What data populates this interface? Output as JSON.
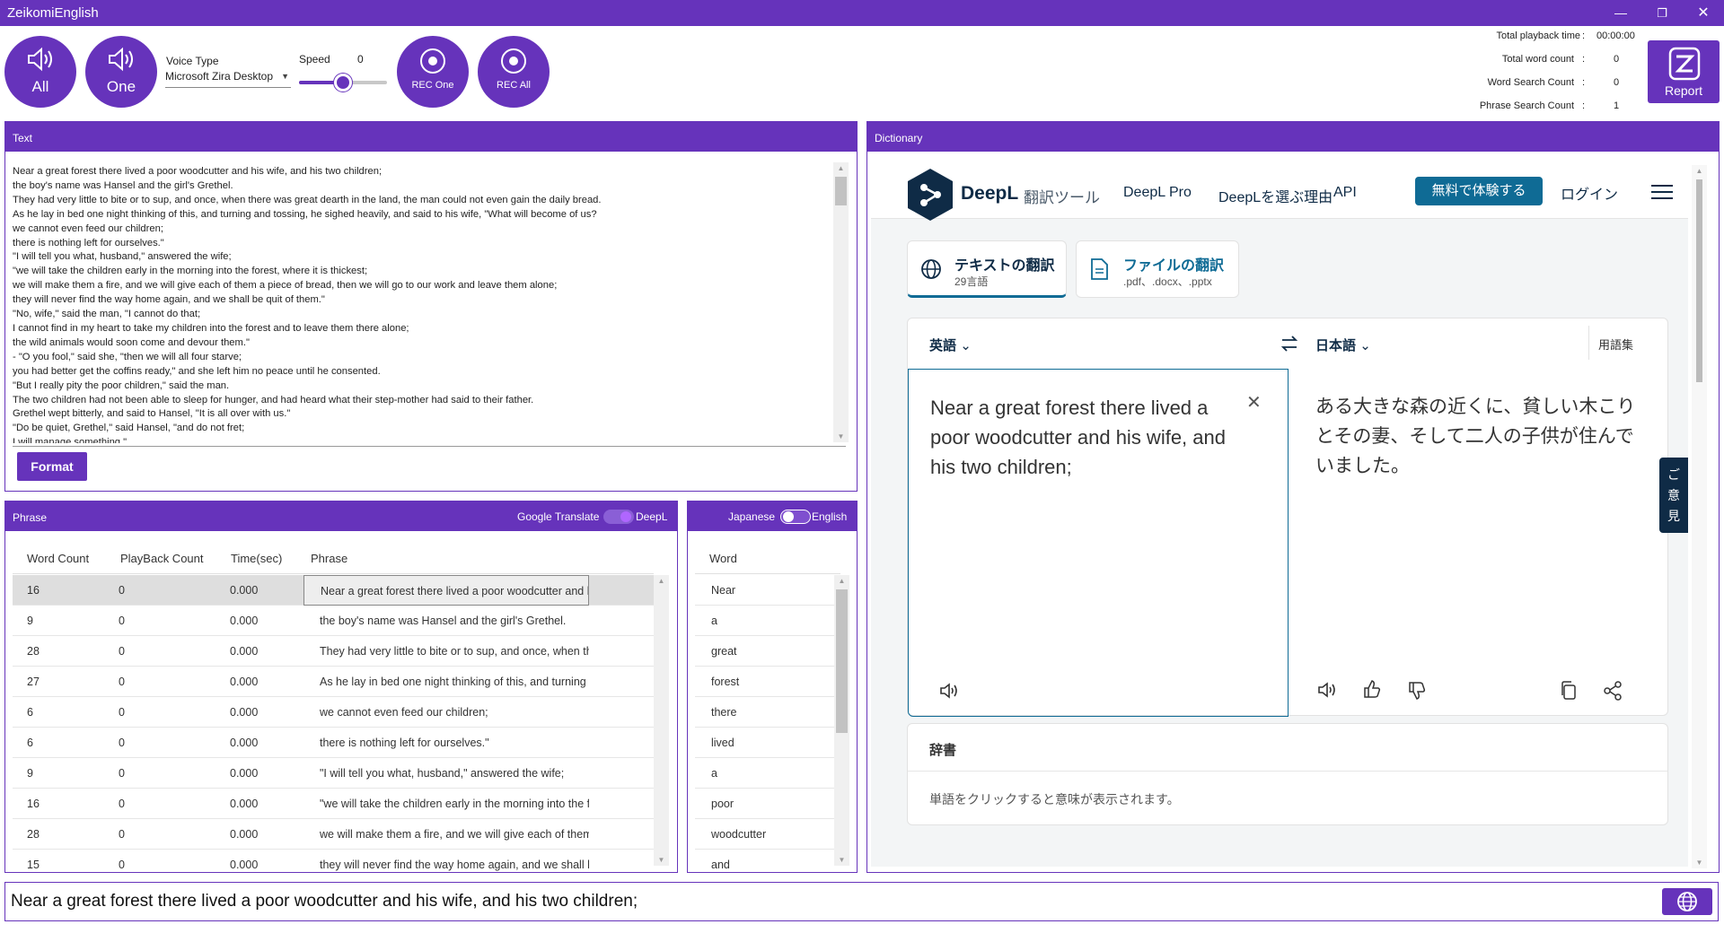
{
  "app": {
    "title": "ZeikomiEnglish"
  },
  "toolbar": {
    "all_label": "All",
    "one_label": "One",
    "voice_type_label": "Voice Type",
    "voice_value": "Microsoft Zira Desktop",
    "speed_label": "Speed",
    "speed_value": "0",
    "speed_level": 0.5,
    "rec_one_label": "REC One",
    "rec_all_label": "REC All",
    "report_label": "Report"
  },
  "stats": {
    "total_playback_label": "Total playback time",
    "total_playback_value": "00:00:00",
    "total_word_label": "Total word count",
    "total_word_value": "0",
    "word_search_label": "Word Search Count",
    "word_search_value": "0",
    "phrase_search_label": "Phrase Search Count",
    "phrase_search_value": "1",
    "colon": ":"
  },
  "text_panel": {
    "title": "Text",
    "lines": [
      "Near a great forest there lived a poor woodcutter and his wife, and his two children;",
      " the boy's name was Hansel and the girl's Grethel.",
      " They had very little to bite or to sup, and once, when there was great dearth in the land, the man could not even gain the daily bread.",
      " As he lay in bed one night thinking of this, and turning and tossing, he sighed heavily, and said to his wife, \"What will become of us?",
      " we cannot even feed our children;",
      " there is nothing left for ourselves.\"",
      "\"I will tell you what, husband,\" answered the wife;",
      " \"we will take the children early in the morning into the forest, where it is thickest;",
      " we will make them a fire, and we will give each of them a piece of bread, then we will go to our work and leave them alone;",
      " they will never find the way home again, and we shall be quit of them.\"",
      "\"No, wife,\" said the man, \"I cannot do that;",
      " I cannot find in my heart to take my children into the forest and to leave them there alone;",
      " the wild animals would soon come and devour them.\"",
      " - \"O you fool,\" said she, \"then we will all four starve;",
      " you had better get the coffins ready,\" and she left him no peace until he consented.",
      " \"But I really pity the poor children,\" said the man.",
      "The two children had not been able to sleep for hunger, and had heard what their step-mother had said to their father.",
      " Grethel wept bitterly, and said to Hansel, \"It is all over with us.\"",
      " \"Do be quiet, Grethel,\" said Hansel, \"and do not fret;",
      " I will manage something.\""
    ],
    "format_label": "Format"
  },
  "phrase_panel": {
    "title": "Phrase",
    "toggle_left": "Google Translate",
    "toggle_right": "DeepL",
    "columns": [
      "Word Count",
      "PlayBack Count",
      "Time(sec)",
      "Phrase"
    ],
    "rows": [
      {
        "wc": "16",
        "pc": "0",
        "t": "0.000",
        "p": "Near a great forest there lived a poor woodcutter and his wife, and his two children;"
      },
      {
        "wc": "9",
        "pc": "0",
        "t": "0.000",
        "p": "the boy's name was Hansel and the girl's Grethel."
      },
      {
        "wc": "28",
        "pc": "0",
        "t": "0.000",
        "p": "They had very little to bite or to sup, and once, when there was great dearth in the land,"
      },
      {
        "wc": "27",
        "pc": "0",
        "t": "0.000",
        "p": "As he lay in bed one night thinking of this, and turning and tossing, he sighed heavily,"
      },
      {
        "wc": "6",
        "pc": "0",
        "t": "0.000",
        "p": "we cannot even feed our children;"
      },
      {
        "wc": "6",
        "pc": "0",
        "t": "0.000",
        "p": "there is nothing left for ourselves.\""
      },
      {
        "wc": "9",
        "pc": "0",
        "t": "0.000",
        "p": "\"I will tell you what, husband,\" answered the wife;"
      },
      {
        "wc": "16",
        "pc": "0",
        "t": "0.000",
        "p": "\"we will take the children early in the morning into the forest, where it is thickest;"
      },
      {
        "wc": "28",
        "pc": "0",
        "t": "0.000",
        "p": "we will make them a fire, and we will give each of them a piece of bread,"
      },
      {
        "wc": "15",
        "pc": "0",
        "t": "0.000",
        "p": "they will never find the way home again, and we shall be quit of them.\""
      }
    ]
  },
  "word_panel": {
    "toggle_left": "Japanese",
    "toggle_right": "English",
    "column": "Word",
    "words": [
      "Near",
      "a",
      "great",
      "forest",
      "there",
      "lived",
      "a",
      "poor",
      "woodcutter",
      "and"
    ]
  },
  "dictionary_panel": {
    "title": "Dictionary"
  },
  "deepl": {
    "brand": "DeepL",
    "brand_sub": "翻訳ツール",
    "nav_pro": "DeepL Pro",
    "nav_why": "DeepLを選ぶ理由",
    "nav_api": "API",
    "cta": "無料で体験する",
    "login": "ログイン",
    "tab_text_title": "テキストの翻訳",
    "tab_text_sub": "29言語",
    "tab_file_title": "ファイルの翻訳",
    "tab_file_sub": ".pdf、.docx、.pptx",
    "source_lang": "英語",
    "target_lang": "日本語",
    "glossary": "用語集",
    "source_text": "Near a great forest there lived a poor woodcutter and his wife, and his two children;",
    "target_text": "ある大きな森の近くに、貧しい木こりとその妻、そして二人の子供が住んでいました。",
    "dict_title": "辞書",
    "dict_hint": "単語をクリックすると意味が表示されます。",
    "feedback": "ご意見"
  },
  "bottom": {
    "text": "Near a great forest there lived a poor woodcutter and his wife, and his two children;"
  },
  "colors": {
    "accent": "#6633bb",
    "deepl_navy": "#0f2b46",
    "deepl_blue": "#0f6b95"
  }
}
